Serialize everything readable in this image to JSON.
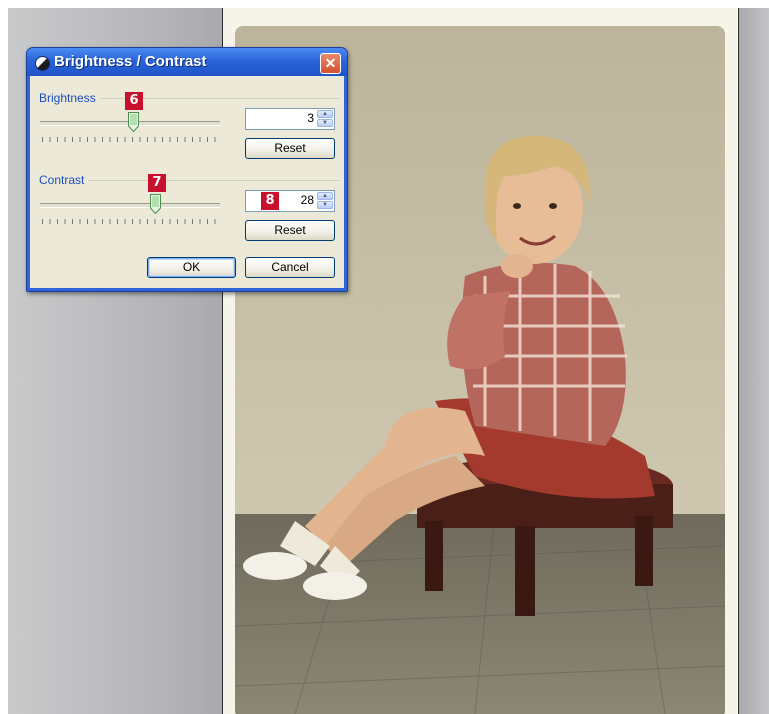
{
  "dialog": {
    "title": "Brightness / Contrast",
    "close_glyph": "✕",
    "brightness": {
      "label": "Brightness",
      "value": "3",
      "slider_fraction": 0.52,
      "reset_label": "Reset",
      "marker": "6"
    },
    "contrast": {
      "label": "Contrast",
      "value": "28",
      "slider_fraction": 0.64,
      "reset_label": "Reset",
      "marker_slider": "7",
      "marker_value": "8"
    },
    "ok_label": "OK",
    "cancel_label": "Cancel"
  },
  "icons": {
    "title": "brightness-contrast-icon",
    "close": "close-icon",
    "spin_up": "spin-up-icon",
    "spin_down": "spin-down-icon"
  },
  "colors": {
    "title_bar": "#2b63d9",
    "dialog_body": "#ece9d8",
    "marker": "#c8102e",
    "close_button": "#d3502b"
  }
}
